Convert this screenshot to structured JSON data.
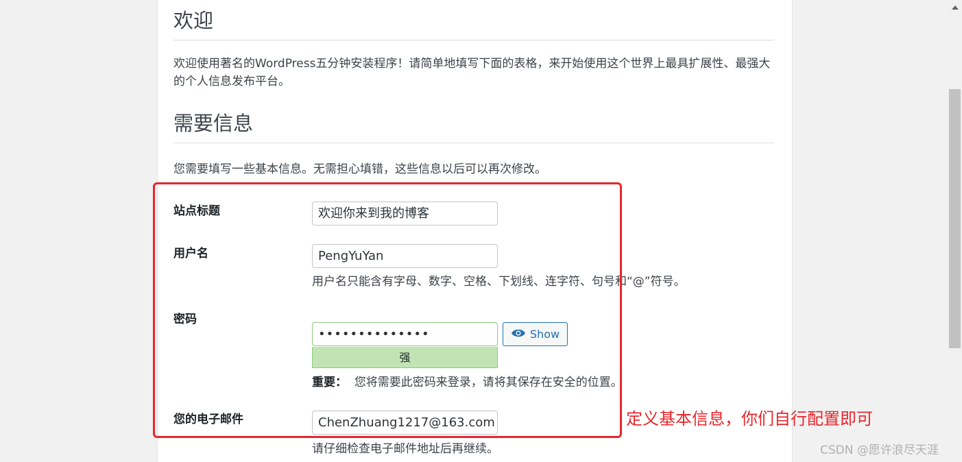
{
  "welcome": {
    "title": "欢迎",
    "text": "欢迎使用著名的WordPress五分钟安装程序！请简单地填写下面的表格，来开始使用这个世界上最具扩展性、最强大的个人信息发布平台。"
  },
  "info": {
    "title": "需要信息",
    "text": "您需要填写一些基本信息。无需担心填错，这些信息以后可以再次修改。"
  },
  "form": {
    "site_title": {
      "label": "站点标题",
      "value": "欢迎你来到我的博客"
    },
    "username": {
      "label": "用户名",
      "value": "PengYuYan",
      "hint": "用户名只能含有字母、数字、空格、下划线、连字符、句号和“@”符号。"
    },
    "password": {
      "label": "密码",
      "value": "••••••••••••••",
      "show_label": "Show",
      "strength": "强",
      "important_label": "重要：",
      "important_text": "您将需要此密码来登录，请将其保存在安全的位置。"
    },
    "email": {
      "label": "您的电子邮件",
      "value": "ChenZhuang1217@163.com",
      "hint": "请仔细检查电子邮件地址后再继续。"
    }
  },
  "annotation": "定义基本信息，你们自行配置即可",
  "watermark": "CSDN @愿许浪尽天涯",
  "colors": {
    "annotation_red": "#e8262c",
    "strength_green": "#c2e4b5",
    "button_blue": "#2271b1"
  }
}
